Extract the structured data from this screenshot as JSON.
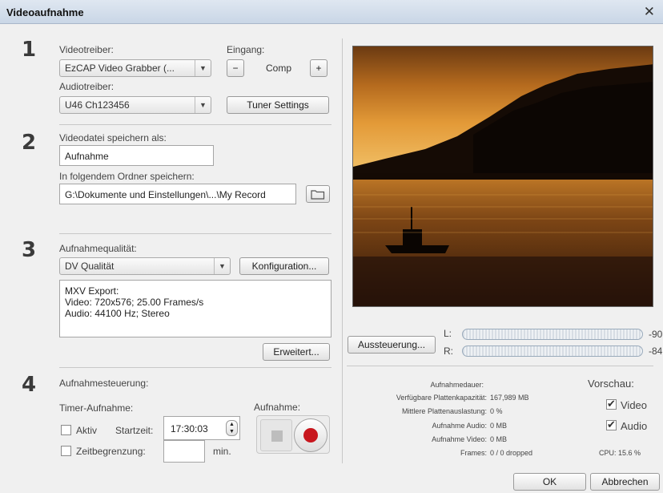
{
  "window": {
    "title": "Videoaufnahme"
  },
  "section1": {
    "step": "1",
    "video_driver_label": "Videotreiber:",
    "video_driver_value": "EzCAP Video Grabber (...",
    "input_label": "Eingang:",
    "input_value": "Comp",
    "minus": "−",
    "plus": "+",
    "audio_driver_label": "Audiotreiber:",
    "audio_driver_value": "U46 Ch123456",
    "tuner_button": "Tuner Settings"
  },
  "section2": {
    "step": "2",
    "save_as_label": "Videodatei speichern als:",
    "filename_value": "Aufnahme",
    "folder_label": "In folgendem Ordner speichern:",
    "folder_value": "G:\\Dokumente und Einstellungen\\...\\My Record"
  },
  "section3": {
    "step": "3",
    "quality_label": "Aufnahmequalität:",
    "quality_value": "DV Qualität",
    "config_button": "Konfiguration...",
    "info_line1": "MXV Export:",
    "info_line2": "Video: 720x576; 25.00 Frames/s",
    "info_line3": "Audio: 44100 Hz; Stereo",
    "advanced_button": "Erweitert..."
  },
  "section4": {
    "step": "4",
    "control_label": "Aufnahmesteuerung:",
    "timer_label": "Timer-Aufnahme:",
    "active_label": "Aktiv",
    "start_label": "Startzeit:",
    "start_value": "17:30:03",
    "limit_label": "Zeitbegrenzung:",
    "limit_value": "",
    "min_label": "min.",
    "record_label": "Aufnahme:"
  },
  "levels": {
    "button": "Aussteuerung...",
    "left_label": "L:",
    "right_label": "R:",
    "left_value": "-90",
    "right_value": "-84"
  },
  "stats": {
    "duration_label": "Aufnahmedauer:",
    "duration_value": "",
    "capacity_label": "Verfügbare Plattenkapazität:",
    "capacity_value": "167,989 MB",
    "usage_label": "Mittlere Plattenauslastung:",
    "usage_value": "0 %",
    "audio_label": "Aufnahme Audio:",
    "audio_value": "0 MB",
    "video_label": "Aufnahme Video:",
    "video_value": "0 MB",
    "frames_label": "Frames:",
    "frames_value": "0 / 0 dropped"
  },
  "preview_opts": {
    "title": "Vorschau:",
    "video_label": "Video",
    "video_checked": true,
    "audio_label": "Audio",
    "audio_checked": true,
    "cpu_label": "CPU:",
    "cpu_value": "15.6 %"
  },
  "footer": {
    "ok": "OK",
    "cancel": "Abbrechen"
  }
}
